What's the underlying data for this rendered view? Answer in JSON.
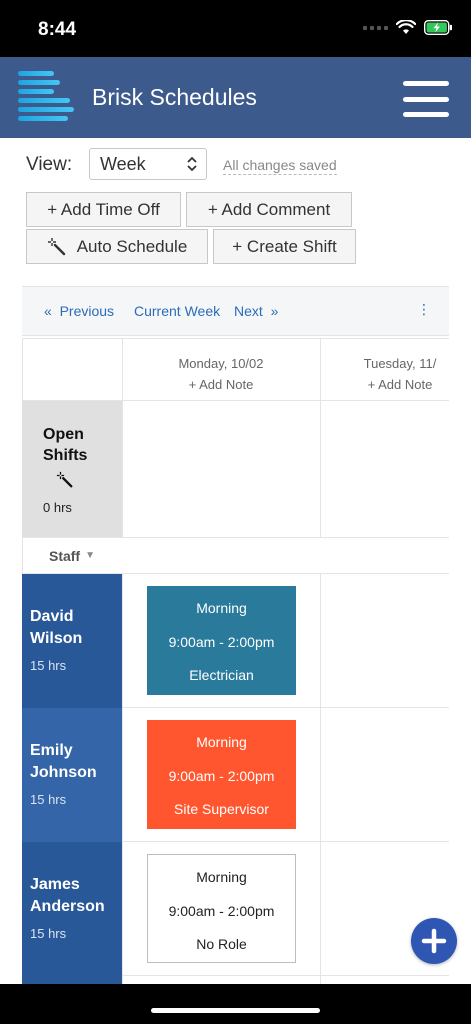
{
  "status_bar": {
    "time": "8:44"
  },
  "header": {
    "title": "Brisk Schedules"
  },
  "toolbar": {
    "view_label": "View:",
    "view_value": "Week",
    "save_status": "All changes saved",
    "add_time_off": "+ Add Time Off",
    "add_comment": "+ Add Comment",
    "auto_schedule": "Auto Schedule",
    "create_shift": "+ Create Shift"
  },
  "nav": {
    "previous": "Previous",
    "current": "Current Week",
    "next": "Next",
    "more": "⋮"
  },
  "days": [
    {
      "date": "Monday, 10/02",
      "add_note": "+ Add Note"
    },
    {
      "date": "Tuesday, 11/",
      "add_note": "+ Add Note"
    }
  ],
  "open_shifts": {
    "title_line1": "Open",
    "title_line2": "Shifts",
    "hours": "0 hrs"
  },
  "staff_header": {
    "label": "Staff",
    "caret": "▼"
  },
  "staff": [
    {
      "first": "David",
      "last": "Wilson",
      "hours": "15 hrs",
      "color": "#295899",
      "shift": {
        "name": "Morning",
        "time": "9:00am - 2:00pm",
        "role": "Electrician",
        "bg": "#2a7a9c",
        "fg": "#ffffff"
      }
    },
    {
      "first": "Emily",
      "last": "Johnson",
      "hours": "15 hrs",
      "color": "#3465a8",
      "shift": {
        "name": "Morning",
        "time": "9:00am - 2:00pm",
        "role": "Site Supervisor",
        "bg": "#ff5630",
        "fg": "#ffffff"
      }
    },
    {
      "first": "James",
      "last": "Anderson",
      "hours": "15 hrs",
      "color": "#295899",
      "shift": {
        "name": "Morning",
        "time": "9:00am - 2:00pm",
        "role": "No Role",
        "bg": "#ffffff",
        "fg": "#222222"
      }
    }
  ],
  "icons": {
    "logo": "brisk-logo-icon",
    "menu": "hamburger-menu-icon",
    "wand": "magic-wand-icon",
    "fab": "plus-icon"
  },
  "colors": {
    "header": "#3d5a8c",
    "link": "#2b6cb8",
    "fab": "#2f56b3"
  }
}
